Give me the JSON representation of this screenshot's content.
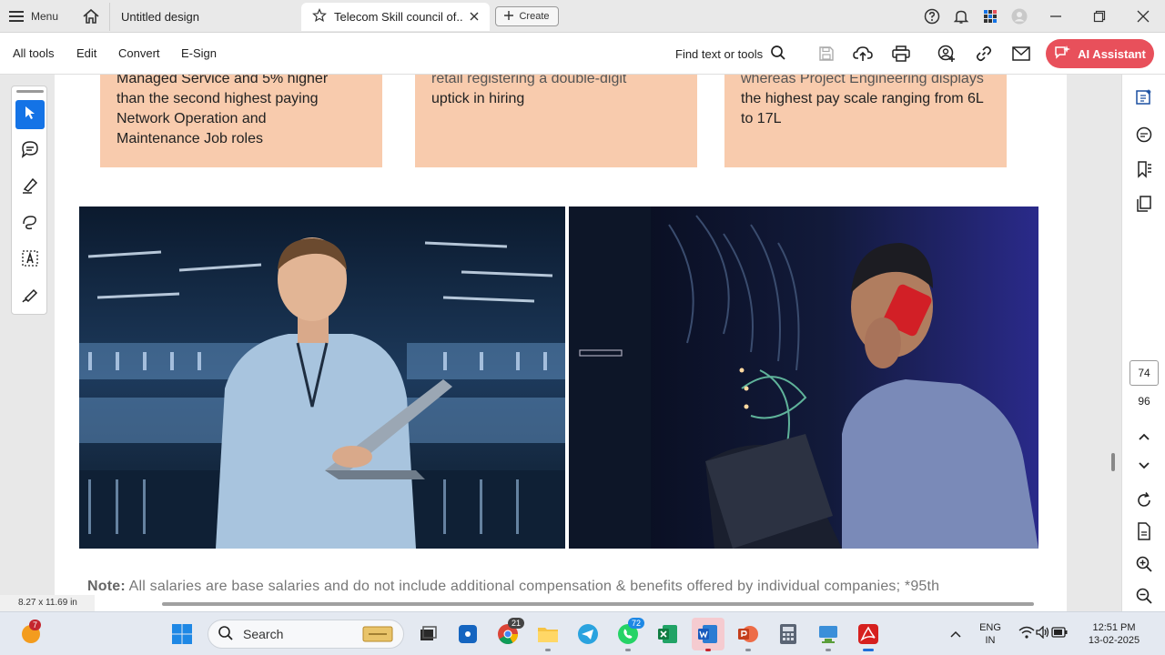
{
  "tabbar": {
    "menu_label": "Menu",
    "tab1_title": "Untitled design",
    "tab2_title": "Telecom Skill council of...",
    "create_label": "Create"
  },
  "toolbar": {
    "all_tools": "All tools",
    "edit": "Edit",
    "convert": "Convert",
    "esign": "E-Sign",
    "find_label": "Find text or tools",
    "ai_assistant": "AI Assistant"
  },
  "document": {
    "card1_lines": [
      "Managed Service and 5% higher",
      "than the second highest paying",
      "Network Operation and",
      "Maintenance Job roles"
    ],
    "card2_lines": [
      "retail   registering   a   double-digit",
      "uptick in hiring"
    ],
    "card3_lines": [
      "whereas Project Engineering displays",
      "the highest pay scale ranging from 6L",
      "to 17L"
    ],
    "note_label": "Note:",
    "note_text": " All salaries are base salaries and do not include additional compensation & benefits offered by individual companies; *95th",
    "page_size": "8.27 x 11.69 in"
  },
  "rail": {
    "current_page": "74",
    "total_pages": "96"
  },
  "taskbar": {
    "search_placeholder": "Search",
    "notification_count": "7",
    "whatsapp_count": "72",
    "chrome_badge": "21",
    "lang_top": "ENG",
    "lang_bottom": "IN",
    "time": "12:51 PM",
    "date": "13-02-2025"
  },
  "colors": {
    "accent_blue": "#1473e6",
    "ai_button": "#e8505b",
    "card_fill": "#f8cbad"
  }
}
